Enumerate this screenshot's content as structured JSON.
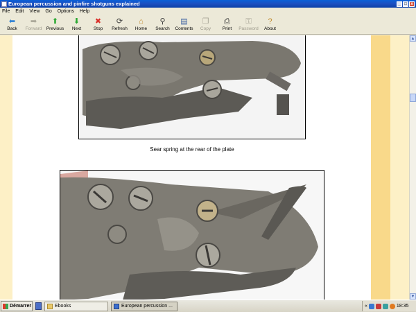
{
  "window": {
    "title": "European percussion and pinfire shotguns explained",
    "buttons": [
      "_",
      "□",
      "x"
    ]
  },
  "menu": [
    "File",
    "Edit",
    "View",
    "Go",
    "Options",
    "Help"
  ],
  "toolbar": [
    {
      "label": "Back",
      "icon": "back-arrow-icon",
      "glyph": "⬅",
      "color": "#2b7fd4",
      "enabled": true
    },
    {
      "label": "Forward",
      "icon": "forward-arrow-icon",
      "glyph": "➡",
      "color": "#a8a596",
      "enabled": false
    },
    {
      "label": "Previous",
      "icon": "up-arrow-icon",
      "glyph": "⬆",
      "color": "#2aa832",
      "enabled": true
    },
    {
      "label": "Next",
      "icon": "down-arrow-icon",
      "glyph": "⬇",
      "color": "#2aa832",
      "enabled": true
    },
    {
      "label": "Stop",
      "icon": "stop-icon",
      "glyph": "✖",
      "color": "#d9302a",
      "enabled": true
    },
    {
      "label": "Refresh",
      "icon": "refresh-icon",
      "glyph": "⟳",
      "color": "#3a3a3a",
      "enabled": true
    },
    {
      "label": "Home",
      "icon": "home-icon",
      "glyph": "⌂",
      "color": "#c0892a",
      "enabled": true
    },
    {
      "label": "Search",
      "icon": "search-icon",
      "glyph": "⚲",
      "color": "#3a3a3a",
      "enabled": true
    },
    {
      "label": "Contents",
      "icon": "contents-icon",
      "glyph": "▤",
      "color": "#3a5fa0",
      "enabled": true
    },
    {
      "label": "Copy",
      "icon": "copy-icon",
      "glyph": "❐",
      "color": "#a8a596",
      "enabled": false
    },
    {
      "label": "Print",
      "icon": "print-icon",
      "glyph": "⎙",
      "color": "#3a3a3a",
      "enabled": true
    },
    {
      "label": "Password",
      "icon": "key-icon",
      "glyph": "⚿",
      "color": "#a8a596",
      "enabled": false
    },
    {
      "label": "About",
      "icon": "question-icon",
      "glyph": "?",
      "color": "#c0892a",
      "enabled": true
    }
  ],
  "content": {
    "caption": "Sear spring at the rear of the plate"
  },
  "colors": {
    "side_strip": "#fdf0c6",
    "accent_strip": "#f9d98a"
  },
  "taskbar": {
    "start_label": "Démarrer",
    "tasks": [
      {
        "label": "Ebooks",
        "icon": "folder-icon"
      },
      {
        "label": "European percussion ...",
        "icon": "ebook-reader-icon"
      }
    ],
    "tray_chevron": "«",
    "clock": "18:35"
  }
}
